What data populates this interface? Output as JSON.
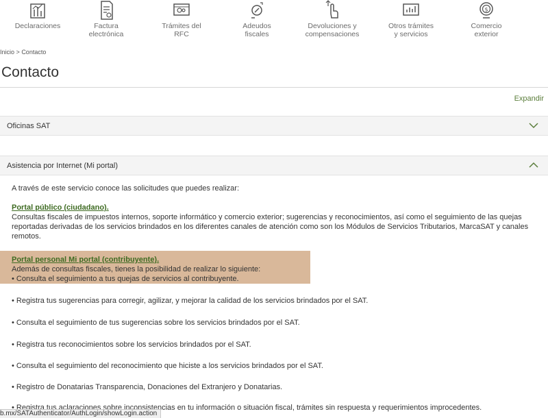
{
  "nav": {
    "items": [
      {
        "label": "Declaraciones",
        "icon": "declarations-icon"
      },
      {
        "label": "Factura\nelectrónica",
        "icon": "invoice-icon"
      },
      {
        "label": "Trámites del\nRFC",
        "icon": "rfc-icon"
      },
      {
        "label": "Adeudos\nfiscales",
        "icon": "debts-icon"
      },
      {
        "label": "Devoluciones y\ncompensaciones",
        "icon": "refunds-icon"
      },
      {
        "label": "Otros trámites\ny servicios",
        "icon": "other-services-icon"
      },
      {
        "label": "Comercio\nexterior",
        "icon": "foreign-trade-icon"
      }
    ]
  },
  "breadcrumb": {
    "home": "Inicio",
    "separator": ">",
    "current": "Contacto"
  },
  "page": {
    "title": "Contacto",
    "expand_label": "Expandir"
  },
  "accordion": {
    "oficinas": {
      "label": "Oficinas SAT",
      "state": "collapsed"
    },
    "asistencia": {
      "label": "Asistencia por Internet (Mi portal)",
      "state": "expanded"
    }
  },
  "content": {
    "intro": "A través de este servicio conoce las solicitudes que puedes realizar:",
    "portal_publico": {
      "heading": "Portal público (ciudadano).",
      "text": "Consultas fiscales de impuestos internos, soporte informático y comercio exterior; sugerencias y reconocimientos, así como el seguimiento de las quejas reportadas derivadas de los servicios brindados en los diferentes canales de atención como son los Módulos de Servicios Tributarios, MarcaSAT y canales remotos."
    },
    "portal_personal": {
      "heading": "Portal personal Mi portal (contribuyente).",
      "text": "Además de consultas fiscales, tienes la posibilidad de realizar lo siguiente:",
      "first_bullet": "• Consulta el seguimiento a tus quejas de servicios al contribuyente."
    },
    "bullets": [
      "• Registra tus sugerencias para corregir, agilizar, y mejorar la calidad de los servicios brindados por el SAT.",
      "• Consulta el seguimiento de tus sugerencias sobre los servicios brindados por el SAT.",
      "• Registra tus reconocimientos sobre los servicios brindados por el SAT.",
      "• Consulta el seguimiento del reconocimiento que hiciste a los servicios brindados por el SAT.",
      "• Registro de Donatarias Transparencia, Donaciones del Extranjero y Donatarias.",
      "• Registra tus aclaraciones sobre inconsistencias en tu información o situación fiscal, trámites sin respuesta y requerimientos improcedentes."
    ]
  },
  "status_bar": {
    "url": "b.mx/SATAuthenticator/AuthLogin/showLogin.action"
  },
  "colors": {
    "link_green": "#3e6b22",
    "highlight": "#cca078",
    "accordion_bg": "#f4f4f4"
  }
}
